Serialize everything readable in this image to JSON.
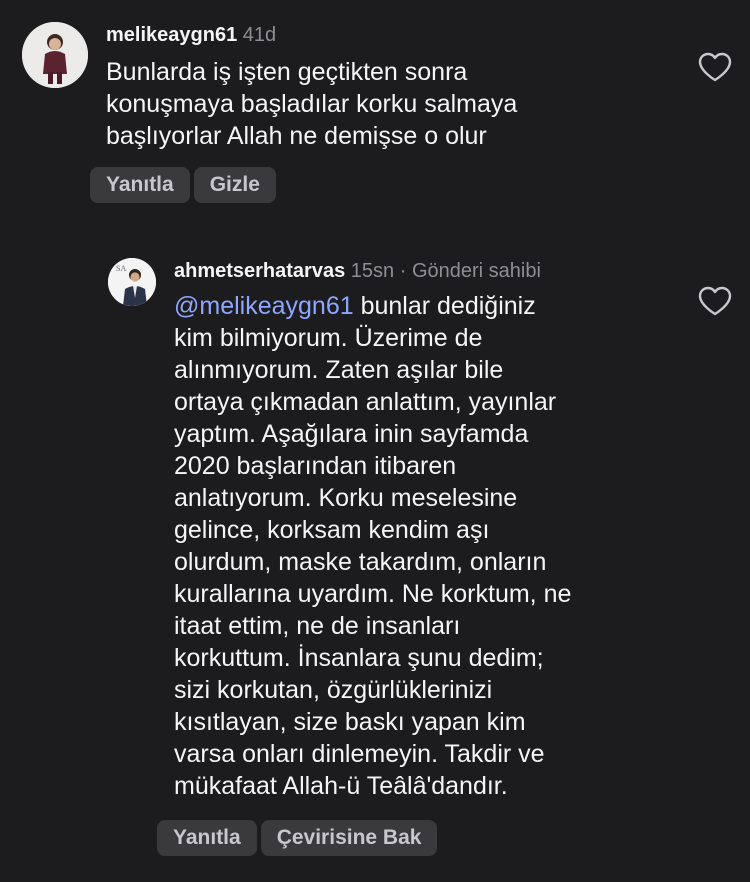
{
  "comments": [
    {
      "username": "melikeaygn61",
      "time": "41d",
      "text": "Bunlarda iş işten geçtikten sonra\nkonuşmaya başladılar korku salmaya\nbaşlıyorlar Allah ne demişse o olur",
      "actions": [
        "Yanıtla",
        "Gizle"
      ],
      "like_icon": "heart-outline-icon"
    },
    {
      "username": "ahmetserhatarvas",
      "time": "15sn",
      "separator": "·",
      "owner_label": "Gönderi sahibi",
      "mention": "@melikeaygn61",
      "text_first_line": " bunlar dediğiniz",
      "text": "kim bilmiyorum. Üzerime de\nalınmıyorum. Zaten aşılar bile\nortaya çıkmadan anlattım, yayınlar\nyaptım. Aşağılara inin sayfamda\n2020 başlarından itibaren\nanlatıyorum. Korku meselesine\ngelince, korksam kendim aşı\nolurdum, maske takardım, onların\nkurallarına uyardım. Ne korktum, ne\nitaat ettim, ne de insanları\nkorkuttum. İnsanlara şunu dedim;\nsizi korkutan, özgürlüklerinizi\nkısıtlayan, size baskı yapan kim\nvarsa onları dinlemeyin. Takdir ve\nmükafaat Allah-ü Teâlâ'dandır.",
      "actions": [
        "Yanıtla",
        "Çevirisine Bak"
      ],
      "like_icon": "heart-outline-icon"
    }
  ],
  "colors": {
    "background": "#1c1c1e",
    "text": "#f5f5f5",
    "muted": "#8e8e93",
    "mention": "#8fa6ff",
    "pill": "#3a3a3c"
  }
}
